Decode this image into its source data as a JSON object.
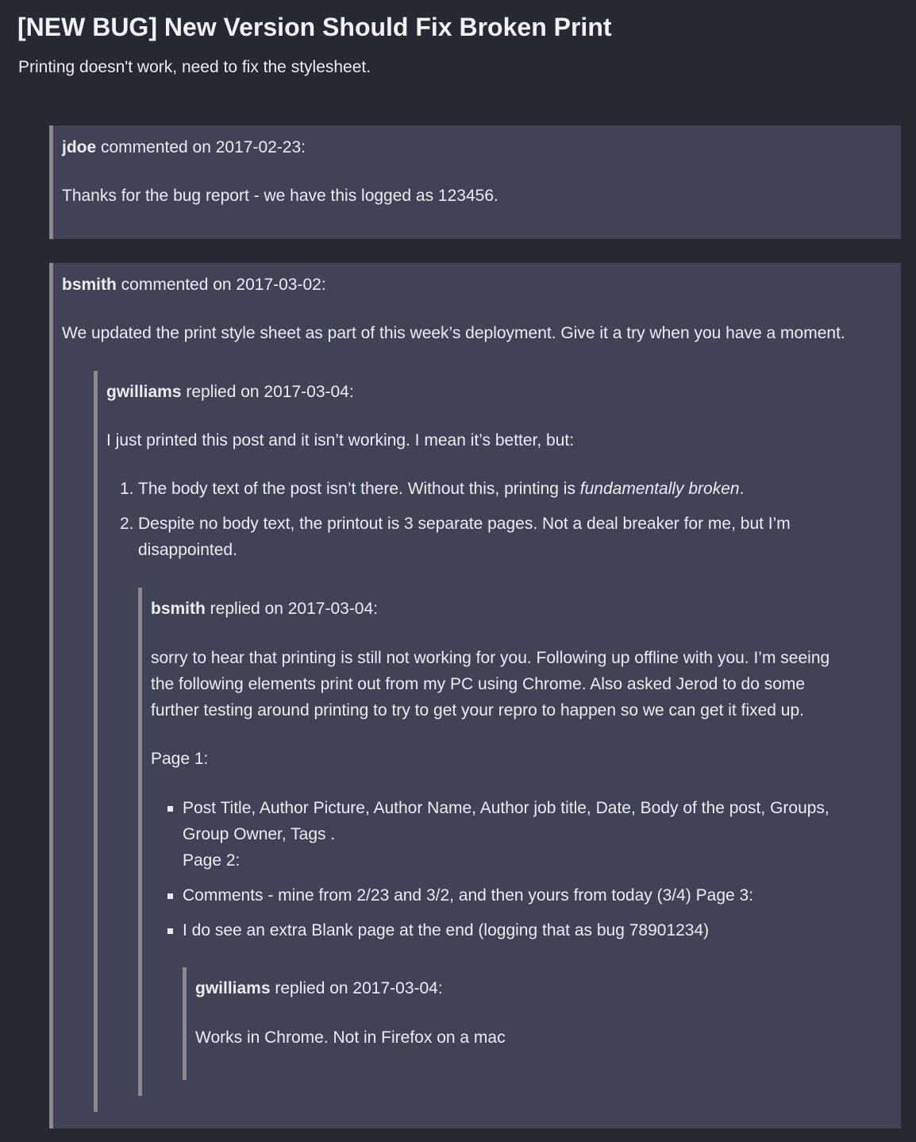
{
  "issue": {
    "title": "[NEW BUG] New Version Should Fix Broken Print",
    "description": "Printing doesn't work, need to fix the stylesheet."
  },
  "comments": [
    {
      "author": "jdoe",
      "action": " commented on 2017-02-23:",
      "body": "Thanks for the bug report - we have this logged as 123456."
    },
    {
      "author": "bsmith",
      "action": " commented on 2017-03-02:",
      "body": "We updated the print style sheet as part of this week’s deployment. Give it a try when you have a moment."
    }
  ],
  "replies": [
    {
      "author": "gwilliams",
      "action": " replied on 2017-03-04:",
      "body": "I just printed this post and it isn’t working. I mean it’s better, but:",
      "list": [
        {
          "number": "1.",
          "text_before": "The body text of the post isn’t there. Without this, printing is ",
          "emphasis": "fundamentally broken",
          "text_after": "."
        },
        {
          "number": "2.",
          "line1": "Despite no body text, the printout is 3 separate pages. Not a deal breaker for me, but I’m",
          "line2": "disappointed."
        }
      ]
    },
    {
      "author": "bsmith",
      "action": " replied on 2017-03-04:",
      "body_lines": [
        "sorry to hear that printing is still not working for you. Following up offline with you. I’m seeing",
        "the following elements print out from my PC using Chrome. Also asked Jerod to do some",
        "further testing around printing to try to get your repro to happen so we can get it fixed up."
      ],
      "page1_label": "Page 1:",
      "bullets": [
        {
          "lines": [
            "Post Title, Author Picture, Author Name, Author job title, Date, Body of the post, Groups,",
            "Group Owner, Tags .",
            "Page 2:"
          ]
        },
        {
          "lines": [
            "Comments - mine from 2/23 and 3/2, and then yours from today (3/4) Page 3:"
          ]
        },
        {
          "lines": [
            "I do see an extra Blank page at the end (logging that as bug 78901234)"
          ]
        }
      ]
    },
    {
      "author": "gwilliams",
      "action": " replied on 2017-03-04:",
      "body": "Works in Chrome. Not in Firefox on a mac"
    }
  ]
}
